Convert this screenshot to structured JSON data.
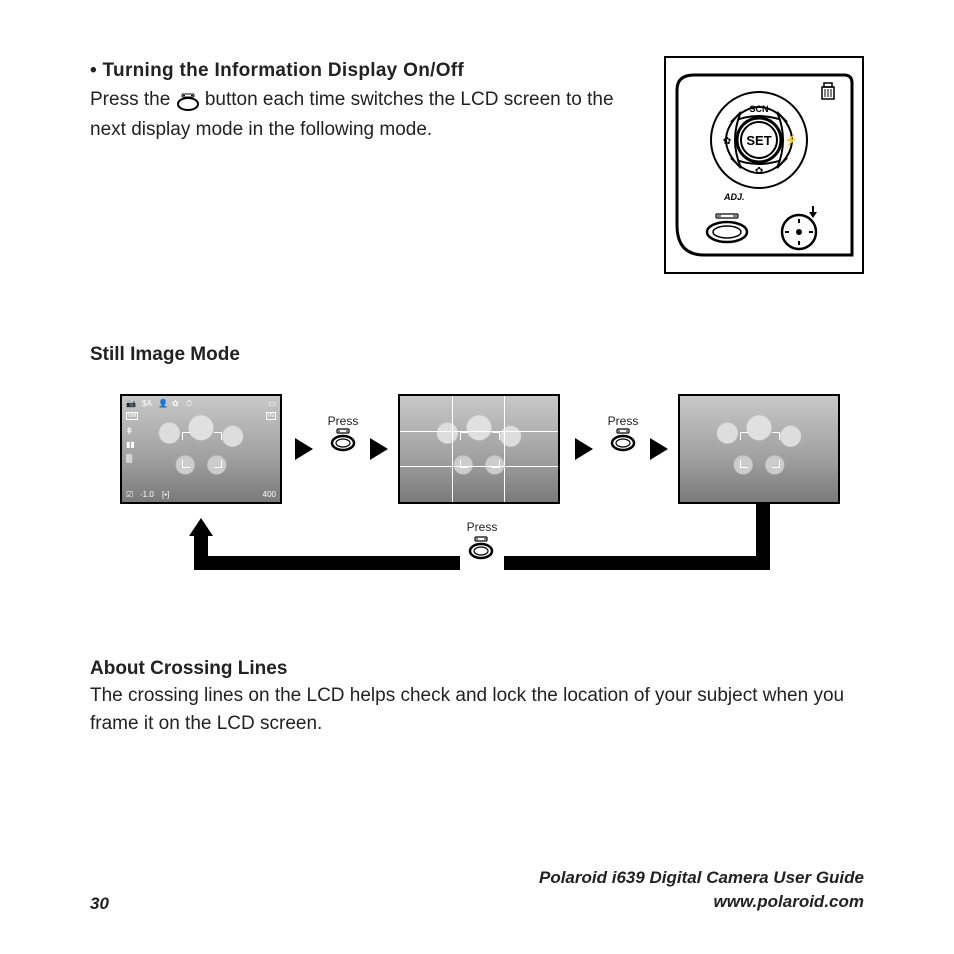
{
  "header": {
    "bullet": "•",
    "title": "Turning the Information Display On/Off",
    "body_before": "Press the ",
    "body_after": " button each time switches the LCD screen to the next display mode in the following mode."
  },
  "section1_title": "Still Image Mode",
  "diagram": {
    "press_label": "Press",
    "osd_left_value": "-1.0",
    "osd_right_value": "400",
    "osd_in": "IN",
    "osd_6m": "6M",
    "osd_flash": "$A"
  },
  "about": {
    "title": "About Crossing Lines",
    "body": "The crossing lines on the LCD helps check and lock the location of your subject when you frame it on the LCD screen."
  },
  "footer": {
    "page": "30",
    "guide": "Polaroid i639 Digital Camera User Guide",
    "url": "www.polaroid.com"
  }
}
